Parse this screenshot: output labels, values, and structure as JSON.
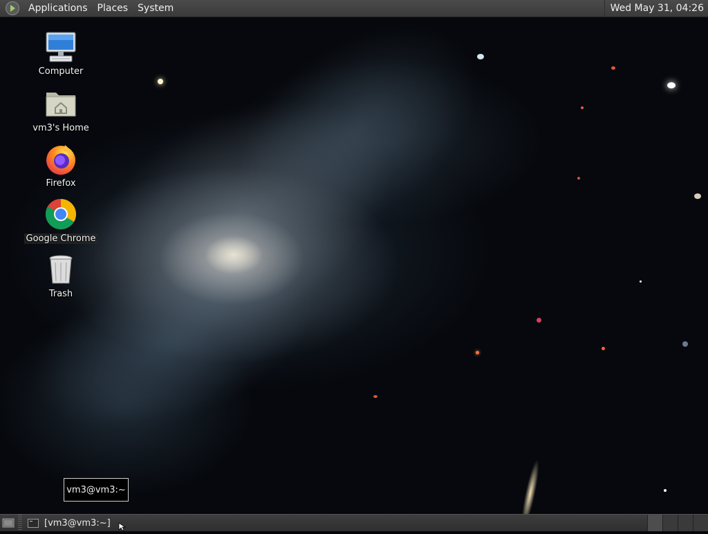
{
  "top_panel": {
    "menus": [
      "Applications",
      "Places",
      "System"
    ],
    "clock": "Wed May 31, 04:26"
  },
  "desktop_icons": [
    {
      "label": "Computer",
      "icon": "computer-icon"
    },
    {
      "label": "vm3's Home",
      "icon": "home-folder-icon"
    },
    {
      "label": "Firefox",
      "icon": "firefox-icon"
    },
    {
      "label": "Google Chrome",
      "icon": "chrome-icon"
    },
    {
      "label": "Trash",
      "icon": "trash-icon"
    }
  ],
  "tooltip": {
    "text": "vm3@vm3:~"
  },
  "taskbar": {
    "tasks": [
      {
        "label": "[vm3@vm3:~]",
        "icon": "terminal-icon"
      }
    ],
    "show_desktop_icon": "show-desktop-icon"
  },
  "colors": {
    "panel": "#3a3a3a",
    "firefox_orange": "#ff7139",
    "chrome_blue": "#4285f4"
  }
}
